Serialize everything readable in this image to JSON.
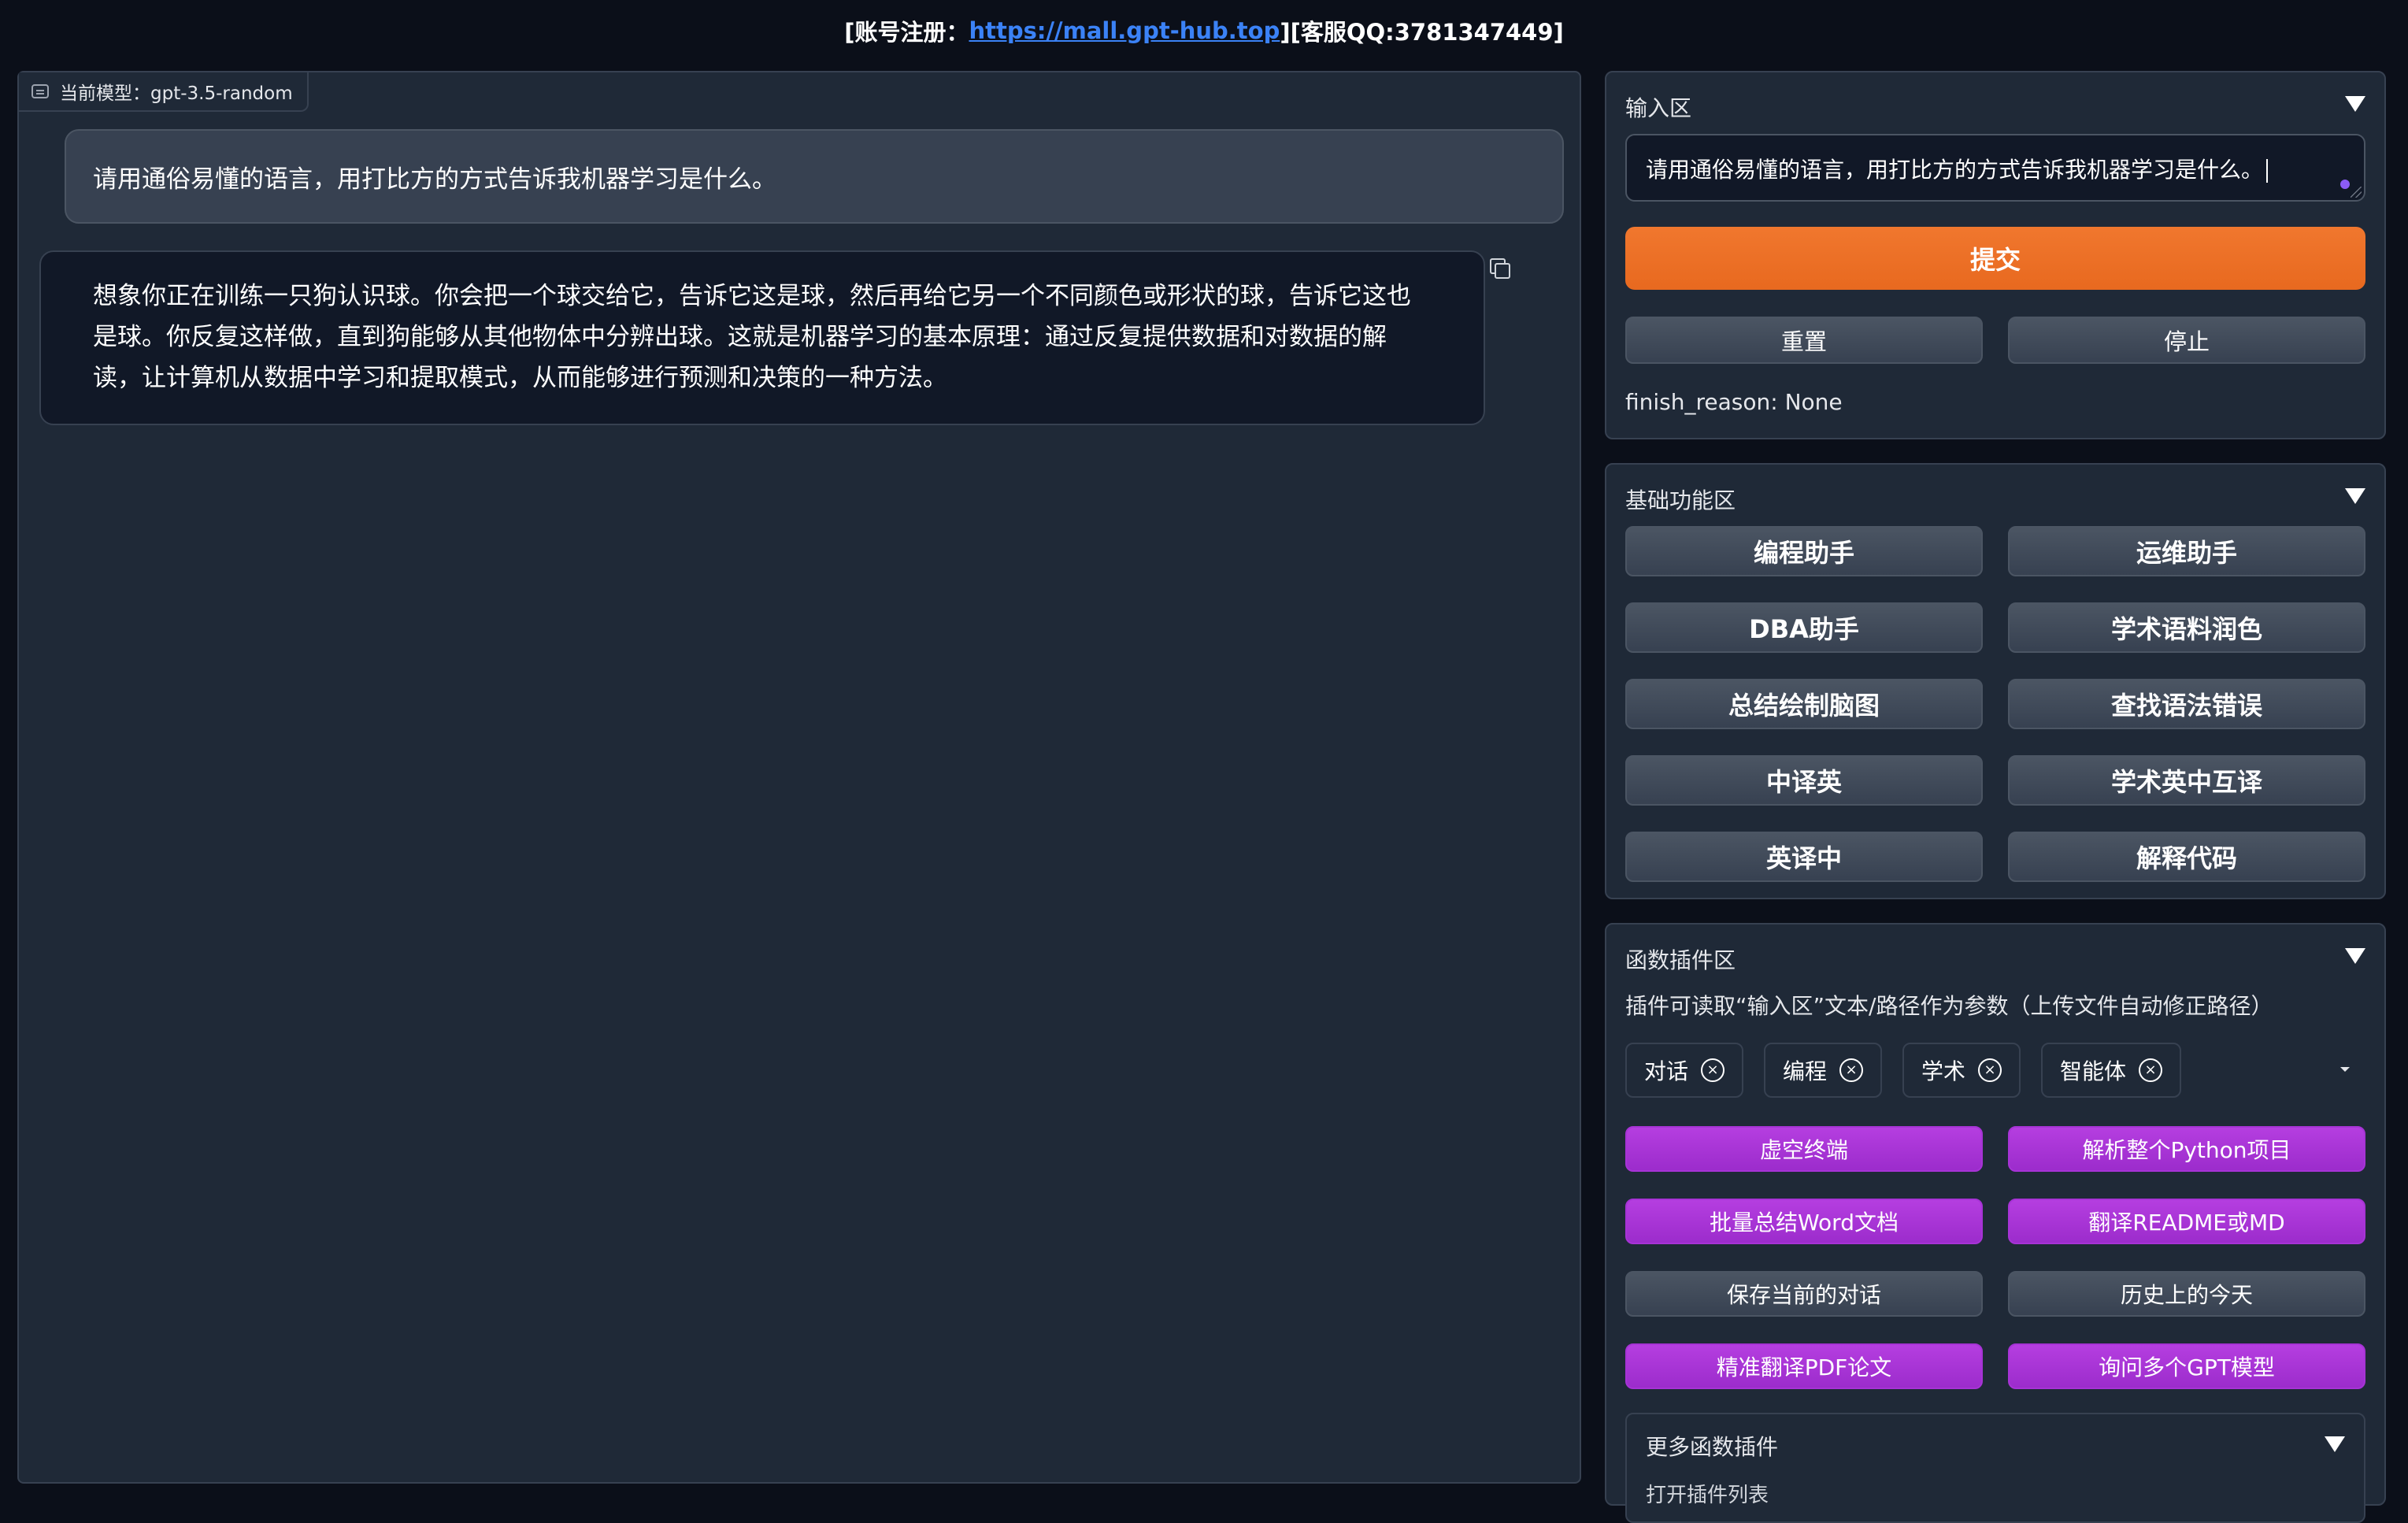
{
  "header": {
    "prefix": "[账号注册：",
    "link": "https://mall.gpt-hub.top",
    "suffix": "][客服QQ:3781347449]"
  },
  "chat": {
    "model_label": "当前模型：gpt-3.5-random",
    "user_message": "请用通俗易懂的语言，用打比方的方式告诉我机器学习是什么。",
    "bot_lines": [
      "想象你正在训练一只狗认识球。你会把一个球交给它，告诉它这是球，然后再给它另一个不同颜色或形状的球，告诉它这也",
      "是球。你反复这样做，直到狗能够从其他物体中分辨出球。这就是机器学习的基本原理：通过反复提供数据和对数据的解",
      "读，让计算机从数据中学习和提取模式，从而能够进行预测和决策的一种方法。"
    ]
  },
  "input_panel": {
    "title": "输入区",
    "text": "请用通俗易懂的语言，用打比方的方式告诉我机器学习是什么。",
    "submit": "提交",
    "reset": "重置",
    "stop": "停止",
    "finish_reason": "finish_reason: None"
  },
  "basic_panel": {
    "title": "基础功能区",
    "buttons": [
      "编程助手",
      "运维助手",
      "DBA助手",
      "学术语料润色",
      "总结绘制脑图",
      "查找语法错误",
      "中译英",
      "学术英中互译",
      "英译中",
      "解释代码"
    ]
  },
  "plugin_panel": {
    "title": "函数插件区",
    "description": "插件可读取“输入区”文本/路径作为参数（上传文件自动修正路径）",
    "tags": [
      "对话",
      "编程",
      "学术",
      "智能体"
    ],
    "tag_remove_glyph": "×",
    "buttons": [
      {
        "label": "虚空终端",
        "style": "purple"
      },
      {
        "label": "解析整个Python项目",
        "style": "purple"
      },
      {
        "label": "批量总结Word文档",
        "style": "purple"
      },
      {
        "label": "翻译README或MD",
        "style": "purple"
      },
      {
        "label": "保存当前的对话",
        "style": "gray"
      },
      {
        "label": "历史上的今天",
        "style": "gray"
      },
      {
        "label": "精准翻译PDF论文",
        "style": "purple"
      },
      {
        "label": "询问多个GPT模型",
        "style": "purple"
      }
    ],
    "more_title": "更多函数插件",
    "more_hint": "打开插件列表"
  },
  "colors": {
    "background": "#0b0f19",
    "panel": "#1f2937",
    "accent_orange": "#e8691f",
    "accent_purple": "#a733d6",
    "link": "#3b82f6"
  }
}
